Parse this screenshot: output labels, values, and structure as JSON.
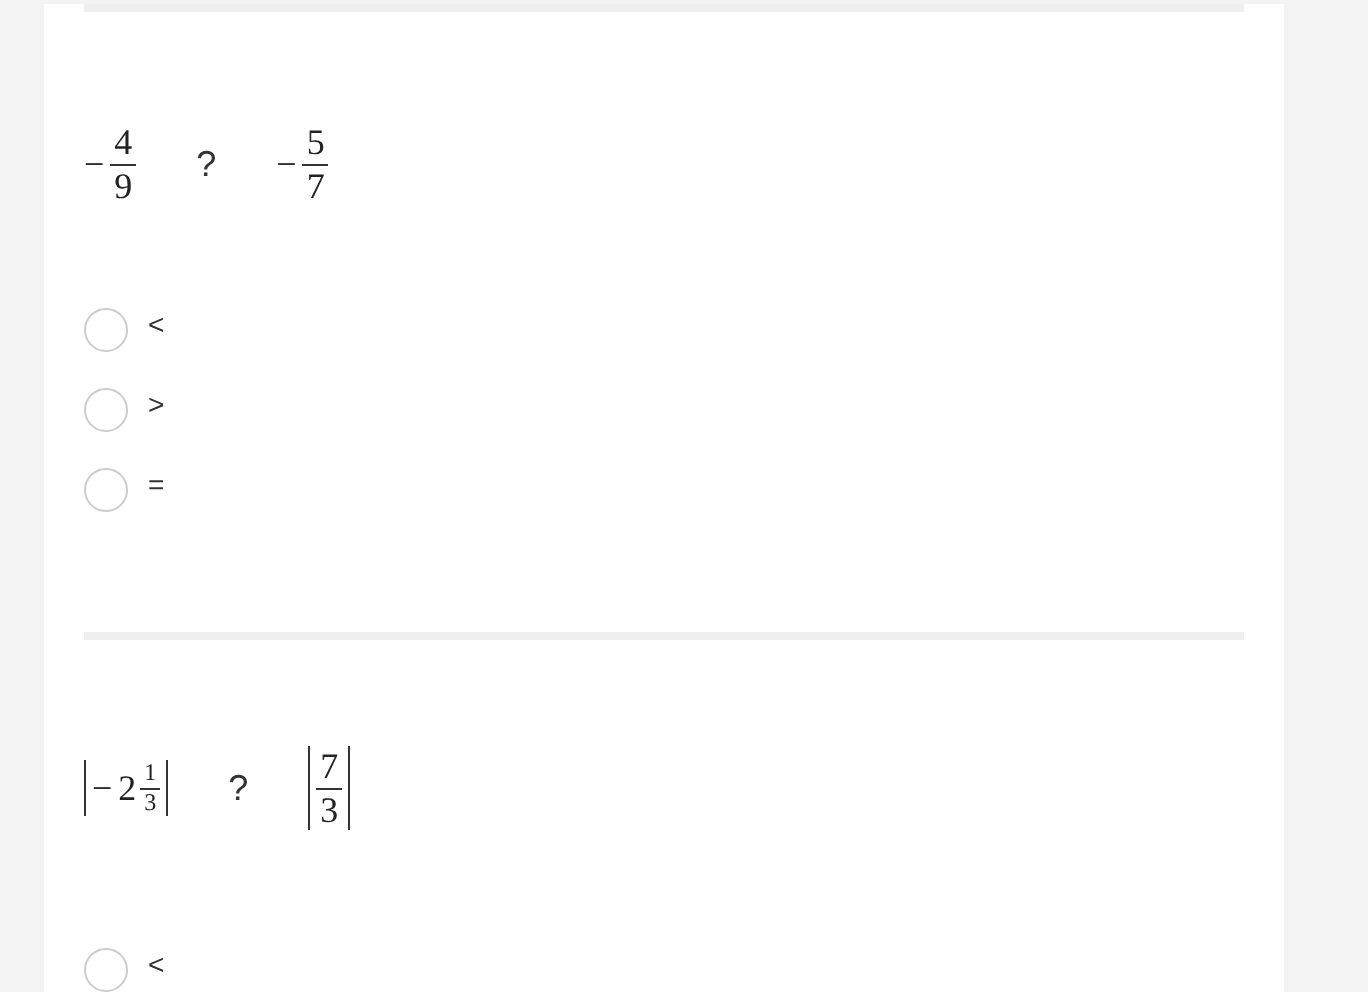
{
  "questions": [
    {
      "left": {
        "kind": "fraction",
        "sign": "−",
        "numerator": "4",
        "denominator": "9",
        "abs": false
      },
      "operator": "?",
      "right": {
        "kind": "fraction",
        "sign": "−",
        "numerator": "5",
        "denominator": "7",
        "abs": false
      },
      "options": [
        {
          "label": "<",
          "selected": false
        },
        {
          "label": ">",
          "selected": false
        },
        {
          "label": "=",
          "selected": false
        }
      ]
    },
    {
      "left": {
        "kind": "mixed",
        "sign": "−",
        "whole": "2",
        "numerator": "1",
        "denominator": "3",
        "abs": true
      },
      "operator": "?",
      "right": {
        "kind": "fraction",
        "numerator": "7",
        "denominator": "3",
        "abs": true
      },
      "options": [
        {
          "label": "<",
          "selected": false
        }
      ]
    }
  ]
}
